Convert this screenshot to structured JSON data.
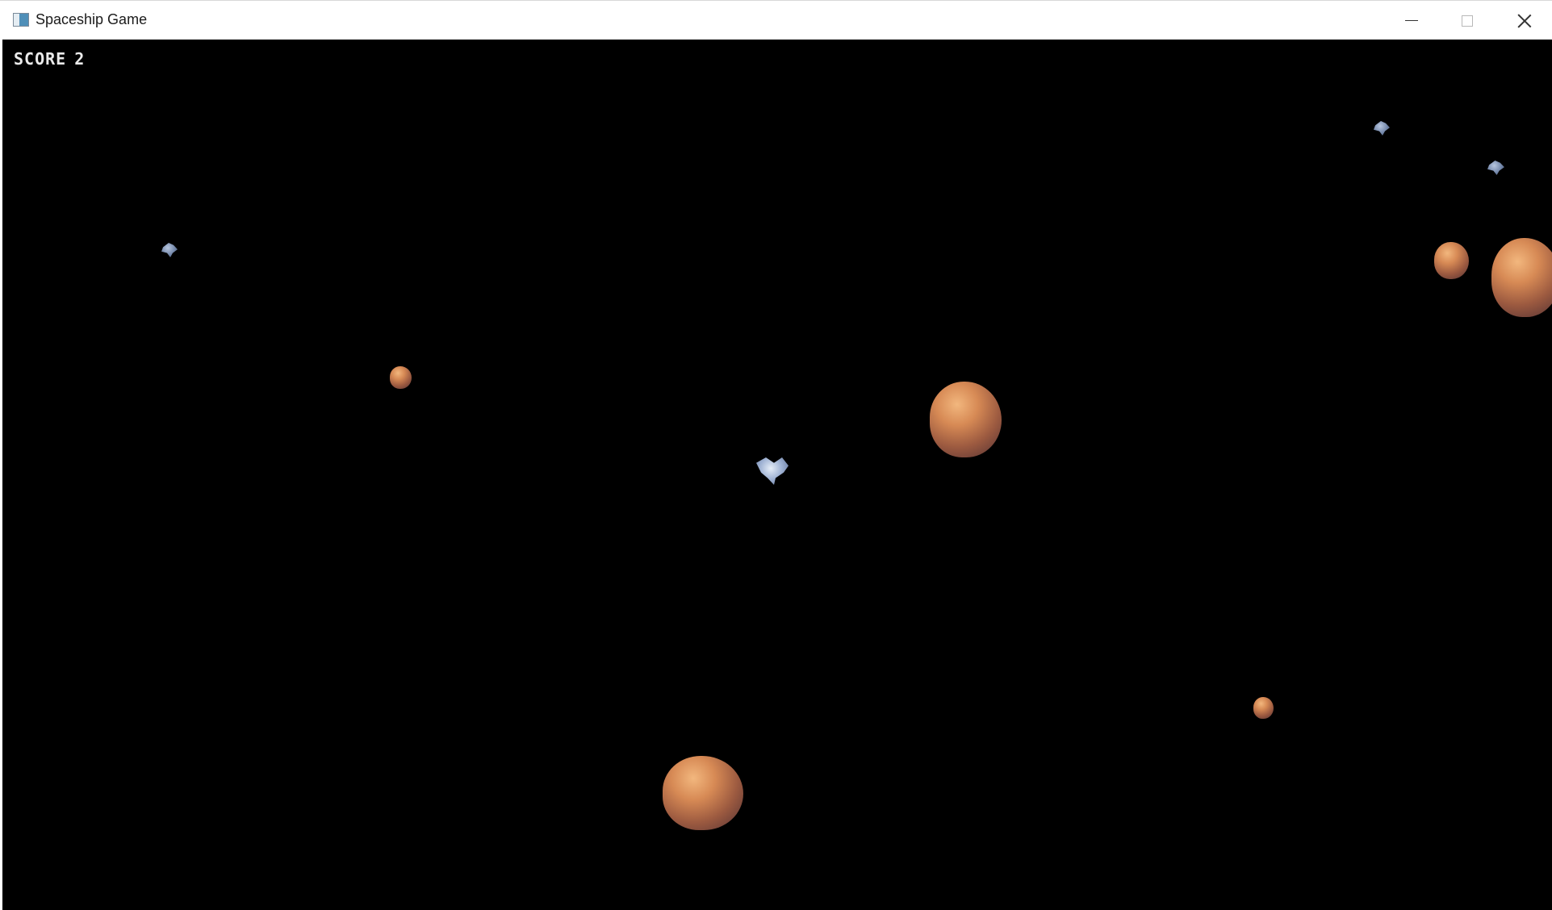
{
  "window": {
    "title": "Spaceship Game",
    "controls": {
      "minimize": "minimize-icon",
      "maximize": "maximize-icon",
      "close": "close-icon"
    }
  },
  "hud": {
    "score_label": "SCORE",
    "score_value": "2"
  },
  "colors": {
    "background": "#000000",
    "asteroid": "#d78a55",
    "debris": "#6f83a6",
    "ship": "#9fb2d3",
    "hud_text": "#eaeaea"
  }
}
